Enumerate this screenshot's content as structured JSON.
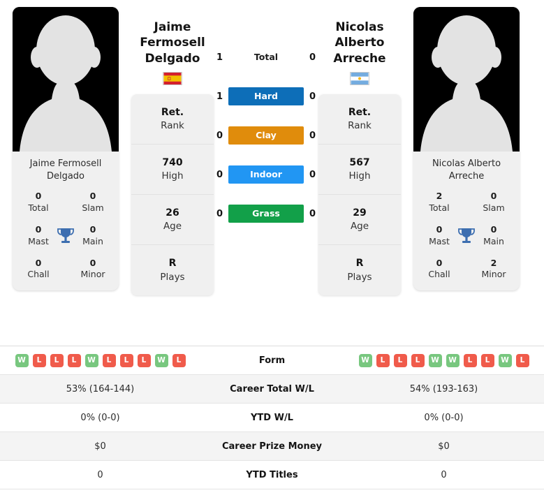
{
  "colors": {
    "hard": "#0d6eb8",
    "clay": "#e08c0c",
    "indoor": "#2196f3",
    "grass": "#12a049",
    "win": "#78c77f",
    "loss": "#f05b4b",
    "trophy": "#3d6eb0"
  },
  "player_left": {
    "display_name_lines": [
      "Jaime",
      "Fermosell",
      "Delgado"
    ],
    "caption_name": "Jaime Fermosell Delgado",
    "country": "Spain",
    "flag": "spain-flag",
    "attributes": [
      {
        "value": "Ret.",
        "label": "Rank"
      },
      {
        "value": "740",
        "label": "High"
      },
      {
        "value": "26",
        "label": "Age"
      },
      {
        "value": "R",
        "label": "Plays"
      }
    ],
    "titles": [
      {
        "value": "0",
        "label": "Total"
      },
      {
        "value": "0",
        "label": "Slam"
      },
      {
        "value": "0",
        "label": "Mast"
      },
      {
        "value": "0",
        "label": "Main"
      },
      {
        "value": "0",
        "label": "Chall"
      },
      {
        "value": "0",
        "label": "Minor"
      }
    ],
    "form": [
      "W",
      "L",
      "L",
      "L",
      "W",
      "L",
      "L",
      "L",
      "W",
      "L"
    ],
    "career_total_wl": "53% (164-144)",
    "ytd_wl": "0% (0-0)",
    "career_prize_money": "$0",
    "ytd_titles": "0"
  },
  "player_right": {
    "display_name_lines": [
      "Nicolas",
      "Alberto",
      "Arreche"
    ],
    "caption_name": "Nicolas Alberto Arreche",
    "country": "Argentina",
    "flag": "argentina-flag",
    "attributes": [
      {
        "value": "Ret.",
        "label": "Rank"
      },
      {
        "value": "567",
        "label": "High"
      },
      {
        "value": "29",
        "label": "Age"
      },
      {
        "value": "R",
        "label": "Plays"
      }
    ],
    "titles": [
      {
        "value": "2",
        "label": "Total"
      },
      {
        "value": "0",
        "label": "Slam"
      },
      {
        "value": "0",
        "label": "Mast"
      },
      {
        "value": "0",
        "label": "Main"
      },
      {
        "value": "0",
        "label": "Chall"
      },
      {
        "value": "2",
        "label": "Minor"
      }
    ],
    "form": [
      "W",
      "L",
      "L",
      "L",
      "W",
      "W",
      "L",
      "L",
      "W",
      "L"
    ],
    "career_total_wl": "54% (193-163)",
    "ytd_wl": "0% (0-0)",
    "career_prize_money": "$0",
    "ytd_titles": "0"
  },
  "head_to_head": [
    {
      "label": "Total",
      "left": "1",
      "right": "0",
      "style": "plain"
    },
    {
      "label": "Hard",
      "left": "1",
      "right": "0",
      "style": "hard"
    },
    {
      "label": "Clay",
      "left": "0",
      "right": "0",
      "style": "clay"
    },
    {
      "label": "Indoor",
      "left": "0",
      "right": "0",
      "style": "indoor"
    },
    {
      "label": "Grass",
      "left": "0",
      "right": "0",
      "style": "grass"
    }
  ],
  "stats_rows": [
    {
      "label": "Form",
      "type": "form"
    },
    {
      "label": "Career Total W/L",
      "type": "text",
      "left": "53% (164-144)",
      "right": "54% (193-163)"
    },
    {
      "label": "YTD W/L",
      "type": "text",
      "left": "0% (0-0)",
      "right": "0% (0-0)"
    },
    {
      "label": "Career Prize Money",
      "type": "text",
      "left": "$0",
      "right": "$0"
    },
    {
      "label": "YTD Titles",
      "type": "text",
      "left": "0",
      "right": "0"
    }
  ]
}
